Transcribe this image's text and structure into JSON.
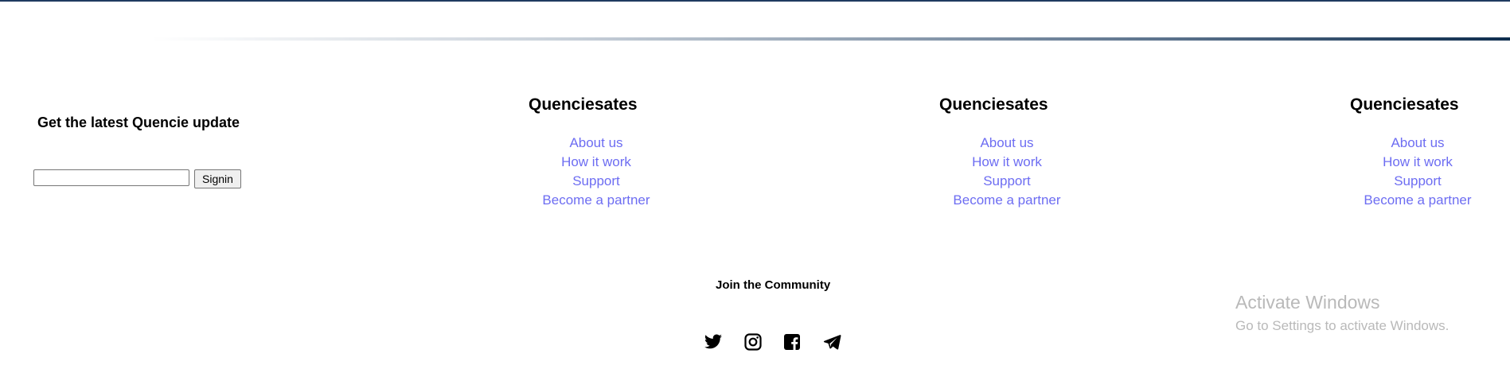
{
  "newsletter": {
    "heading": "Get the latest Quencie update",
    "input_value": "",
    "button_label": "Signin"
  },
  "columns": [
    {
      "title": "Quenciesates",
      "links": [
        "About us",
        "How it work",
        "Support",
        "Become a partner"
      ]
    },
    {
      "title": "Quenciesates",
      "links": [
        "About us",
        "How it work",
        "Support",
        "Become a partner"
      ]
    },
    {
      "title": "Quenciesates",
      "links": [
        "About us",
        "How it work",
        "Support",
        "Become a partner"
      ]
    }
  ],
  "community": {
    "heading": "Join the Community",
    "icons": [
      "twitter-icon",
      "instagram-icon",
      "facebook-icon",
      "telegram-icon"
    ]
  },
  "windows_watermark": {
    "title": "Activate Windows",
    "subtitle": "Go to Settings to activate Windows."
  },
  "colors": {
    "link": "#6d6df2",
    "rule_dark": "#0e2d4e",
    "watermark": "#b9b9b9"
  }
}
